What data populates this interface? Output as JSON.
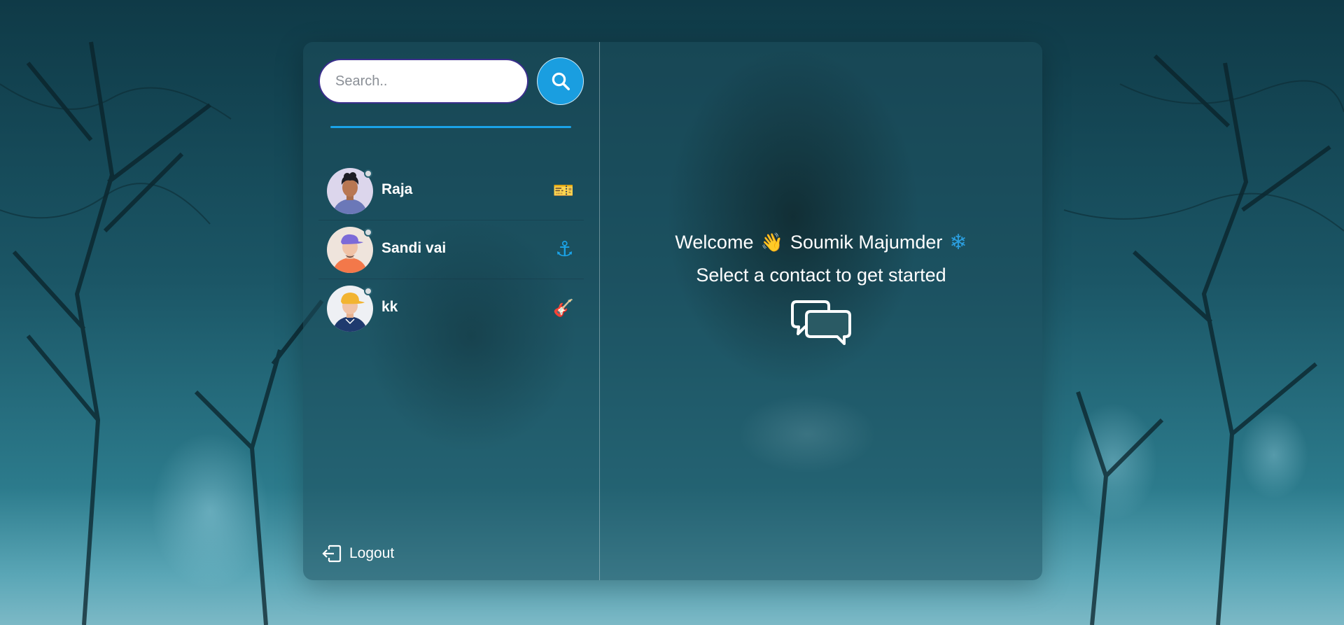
{
  "sidebar": {
    "search": {
      "placeholder": "Search..",
      "value": ""
    },
    "contacts": [
      {
        "name": "Raja",
        "emoji": "🎫"
      },
      {
        "name": "Sandi vai",
        "emoji": "⚓"
      },
      {
        "name": "kk",
        "emoji": "🎸"
      }
    ],
    "logout_label": "Logout"
  },
  "main": {
    "welcome_prefix": "Welcome",
    "wave_emoji": "👋",
    "user_name": "Soumik Majumder",
    "snow_emoji": "❄",
    "subtitle": "Select a contact to get started"
  },
  "colors": {
    "accent": "#1a9ee0",
    "divider": "#1aa3e8",
    "search_border": "#3a2f8c"
  },
  "icons": {
    "search": "search-icon",
    "logout": "logout-icon",
    "chat": "chat-bubbles-icon"
  }
}
